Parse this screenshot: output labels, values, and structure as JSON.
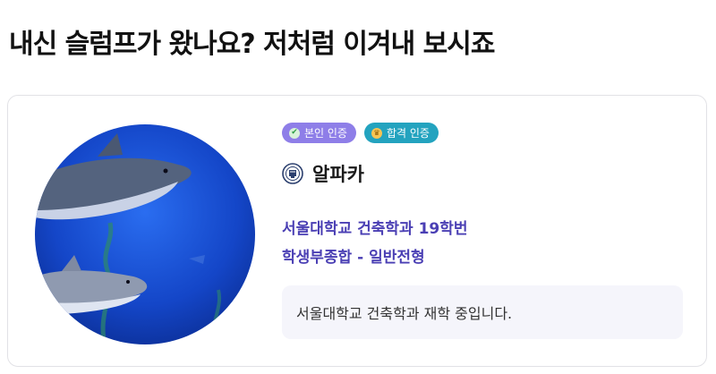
{
  "headline": "내신 슬럼프가 왔나요? 저처럼 이겨내 보시죠",
  "profile": {
    "avatar_icon": "shark-photo",
    "badges": [
      {
        "label": "본인 인증",
        "icon": "check-circle-icon",
        "color": "#8e7ee8"
      },
      {
        "label": "합격 인증",
        "icon": "crown-icon",
        "color": "#23a3bf"
      }
    ],
    "emblem_icon": "university-emblem-icon",
    "nickname": "알파카",
    "school": "서울대학교 건축학과 19학번",
    "admission": "학생부종합 - 일반전형",
    "intro": "서울대학교 건축학과 재학 중입니다."
  }
}
